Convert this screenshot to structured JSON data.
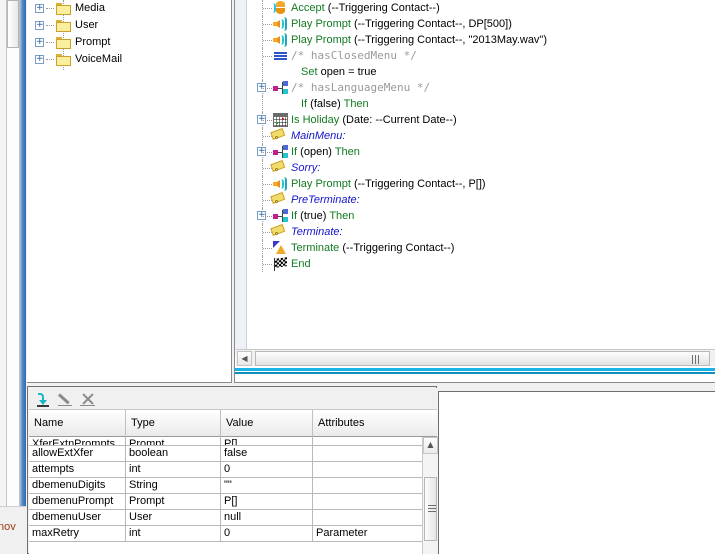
{
  "left_edge": {
    "clipped_text": "nov"
  },
  "tree": {
    "items": [
      {
        "label": "Media",
        "icon": "folder-icon",
        "expander": "+"
      },
      {
        "label": "User",
        "icon": "folder-icon",
        "expander": "+"
      },
      {
        "label": "Prompt",
        "icon": "folder-icon",
        "expander": "+"
      },
      {
        "label": "VoiceMail",
        "icon": "folder-icon",
        "expander": "+"
      }
    ]
  },
  "code": {
    "rows": [
      {
        "icon": "accept-icon",
        "expander": "",
        "indent": "deep",
        "parts": [
          {
            "t": "Accept ",
            "c": "g"
          },
          {
            "t": "(--Triggering Contact--)",
            "c": "b"
          }
        ]
      },
      {
        "icon": "speaker-icon",
        "expander": "",
        "indent": "deep",
        "parts": [
          {
            "t": "Play Prompt ",
            "c": "g"
          },
          {
            "t": "(--Triggering Contact--, DP[500])",
            "c": "b"
          }
        ]
      },
      {
        "icon": "speaker-icon",
        "expander": "",
        "indent": "deep",
        "parts": [
          {
            "t": "Play Prompt ",
            "c": "g"
          },
          {
            "t": "(--Triggering Contact--, \"2013May.wav\")",
            "c": "b"
          }
        ]
      },
      {
        "icon": "bars-icon",
        "expander": "",
        "indent": "deep",
        "parts": [
          {
            "t": "/* hasClosedMenu */",
            "c": "cmt"
          }
        ]
      },
      {
        "icon": "",
        "expander": "",
        "indent": "extra",
        "parts": [
          {
            "t": "Set ",
            "c": "g"
          },
          {
            "t": "open = true",
            "c": "b"
          }
        ]
      },
      {
        "icon": "branch-icon",
        "expander": "+",
        "indent": "deep",
        "parts": [
          {
            "t": "/* hasLanguageMenu */",
            "c": "cmt"
          }
        ]
      },
      {
        "icon": "",
        "expander": "",
        "indent": "extra",
        "parts": [
          {
            "t": "If ",
            "c": "g"
          },
          {
            "t": "(false) ",
            "c": "b"
          },
          {
            "t": "Then",
            "c": "g"
          }
        ]
      },
      {
        "icon": "calendar-icon",
        "expander": "+",
        "indent": "deep",
        "parts": [
          {
            "t": "Is Holiday ",
            "c": "g"
          },
          {
            "t": "(Date: --Current Date--)",
            "c": "b"
          }
        ]
      },
      {
        "icon": "tag-icon",
        "expander": "",
        "indent": "deep",
        "parts": [
          {
            "t": "MainMenu:",
            "c": "lbl"
          }
        ]
      },
      {
        "icon": "branch-icon",
        "expander": "+",
        "indent": "deep",
        "parts": [
          {
            "t": "If ",
            "c": "g"
          },
          {
            "t": "(open) ",
            "c": "b"
          },
          {
            "t": "Then",
            "c": "g"
          }
        ]
      },
      {
        "icon": "tag-icon",
        "expander": "",
        "indent": "deep",
        "parts": [
          {
            "t": "Sorry:",
            "c": "lbl"
          }
        ]
      },
      {
        "icon": "speaker-icon",
        "expander": "",
        "indent": "deep",
        "parts": [
          {
            "t": "Play Prompt ",
            "c": "g"
          },
          {
            "t": "(--Triggering Contact--, P[])",
            "c": "b"
          }
        ]
      },
      {
        "icon": "tag-icon",
        "expander": "",
        "indent": "deep",
        "parts": [
          {
            "t": "PreTerminate:",
            "c": "lbl"
          }
        ]
      },
      {
        "icon": "branch-icon",
        "expander": "+",
        "indent": "deep",
        "parts": [
          {
            "t": "If ",
            "c": "g"
          },
          {
            "t": "(true) ",
            "c": "b"
          },
          {
            "t": "Then",
            "c": "g"
          }
        ]
      },
      {
        "icon": "tag-icon",
        "expander": "",
        "indent": "deep",
        "parts": [
          {
            "t": "Terminate:",
            "c": "lbl"
          }
        ]
      },
      {
        "icon": "terminate-icon",
        "expander": "",
        "indent": "deep",
        "parts": [
          {
            "t": "Terminate ",
            "c": "g"
          },
          {
            "t": "(--Triggering Contact--)",
            "c": "b"
          }
        ]
      },
      {
        "icon": "flag-icon",
        "expander": "",
        "indent": "deep",
        "parts": [
          {
            "t": "End",
            "c": "g"
          }
        ]
      }
    ],
    "hscroll": {
      "left_arrow": "◀",
      "grip": "grip-icon"
    }
  },
  "variables": {
    "toolbar": [
      {
        "name": "import-variable-button",
        "icon": "import-icon",
        "enabled": true
      },
      {
        "name": "edit-variable-button",
        "icon": "pencil-icon",
        "enabled": false
      },
      {
        "name": "delete-variable-button",
        "icon": "delete-x-icon",
        "enabled": false
      }
    ],
    "columns": [
      "Name",
      "Type",
      "Value",
      "Attributes"
    ],
    "rows": [
      {
        "name": "XferExtnPrompts",
        "type": "Prompt",
        "value": "P[]",
        "attributes": "",
        "clipped": true
      },
      {
        "name": "allowExtXfer",
        "type": "boolean",
        "value": "false",
        "attributes": ""
      },
      {
        "name": "attempts",
        "type": "int",
        "value": "0",
        "attributes": ""
      },
      {
        "name": "dbemenuDigits",
        "type": "String",
        "value": "\"\"",
        "attributes": ""
      },
      {
        "name": "dbemenuPrompt",
        "type": "Prompt",
        "value": "P[]",
        "attributes": ""
      },
      {
        "name": "dbemenuUser",
        "type": "User",
        "value": "null",
        "attributes": ""
      },
      {
        "name": "maxRetry",
        "type": "int",
        "value": "0",
        "attributes": "Parameter"
      }
    ],
    "scroll": {
      "up_arrow": "▲"
    }
  },
  "colors": {
    "accent_cyan": "#19b3e6",
    "keyword_green": "#127a22",
    "label_blue": "#1414c8",
    "comment_grey": "#9a9a9a",
    "folder_yellow": "#fbee9e"
  }
}
